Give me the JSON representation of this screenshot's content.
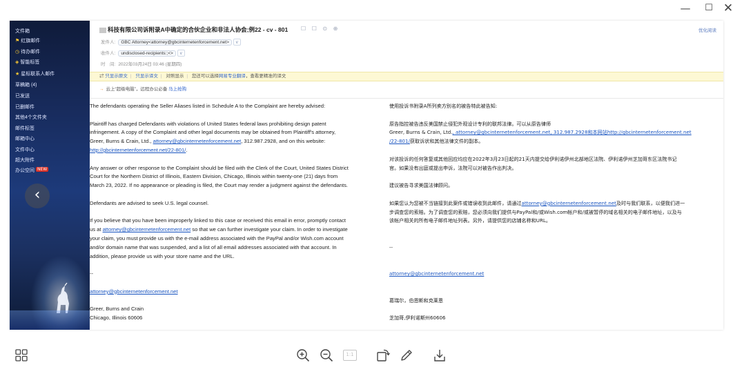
{
  "window": {
    "minimize_glyph": "—",
    "maximize_glyph": "☐",
    "close_glyph": "✕"
  },
  "sidebar": {
    "items": [
      {
        "label": "文件箱",
        "icon": ""
      },
      {
        "label": "红旗邮件",
        "icon": "flag-icon"
      },
      {
        "label": "待办邮件",
        "icon": "clock-icon"
      },
      {
        "label": "智能标签",
        "icon": "tag-icon"
      },
      {
        "label": "星标联系人邮件",
        "icon": "star-icon"
      },
      {
        "label": "草稿箱 (4)",
        "icon": ""
      },
      {
        "label": "已发送",
        "icon": ""
      },
      {
        "label": "已删邮件",
        "icon": ""
      },
      {
        "label": "其他4个文件夹",
        "icon": ""
      },
      {
        "label": "邮件标签",
        "icon": ""
      },
      {
        "label": "邮箱中心",
        "icon": ""
      },
      {
        "label": "文件中心",
        "icon": ""
      },
      {
        "label": "超大附件",
        "icon": ""
      },
      {
        "label": "办公空间",
        "icon": ""
      }
    ],
    "new_badge": "NEW"
  },
  "mail": {
    "subject": "科技有限公司诉附录A中确定的合伙企业和非法人协会;例22 - cv - 801",
    "subject_icons": "☐ ☐ ⊙ ⊕",
    "header_right_link": "优化阅读",
    "from_label": "发件人:",
    "from_value": "GBC Attorney<attorney@gbcinternetenforcement.net>",
    "to_label": "收件人:",
    "to_value": "undisclosed-recipients:;<>",
    "time_label": "时　间:",
    "time_value": "2022年03月24日 03:46 (星期四)",
    "notice": {
      "show_original": "只显示原文",
      "show_translation": "只显示译文",
      "compare": "对照显示",
      "text": "您还可以选择",
      "pro_link": "网易专业翻译",
      "tail": "，查看更精准的译文"
    },
    "cloud": {
      "text": "云上“超级电脑”，远程办公必备",
      "link": "马上抢购"
    }
  },
  "body_en": {
    "p1": [
      "The defendants operating the Seller Aliases listed in Schedule A to the Complaint are hereby advised:"
    ],
    "p2": [
      "Plaintiff has charged Defendants with violations of United States federal laws prohibiting design patent",
      "infringement. A copy of the Complaint and other legal documents may be obtained from Plaintiff's attorney,",
      "Greer, Burns & Crain, Ltd., ",
      "attorney@gbcinternetenforcement.net",
      ", 312.987.2928, and on this website:",
      "http://gbcinternetenforcement.net/22-801/",
      "."
    ],
    "p3": [
      "Any answer or other response to the Complaint should be filed with the Clerk of the Court, United States District",
      "Court for the Northern District of Illinois, Eastern Division, Chicago, Illinois within twenty-one (21) days from",
      "March 23, 2022. If no appearance or pleading is filed, the Court may render a judgment against the defendants."
    ],
    "p4": [
      "Defendants are advised to seek U.S. legal counsel."
    ],
    "p5": [
      "If you believe that you have been improperly linked to this case or received this email in error, promptly contact",
      "us at ",
      "attorney@gbcinternetenforcement.net",
      " so that we can further investigate your claim.  In order to investigate",
      "your claim, you must provide us with the e-mail address associated with the PayPal and/or Wish.com account",
      "and/or domain name that was suspended, and a list of all email addresses associated with that account. In",
      "addition, please provide us with your store name and the URL."
    ],
    "dash": "--",
    "sig_email": "attorney@gbcinternetenforcement.net",
    "sig_firm": "Greer, Burns and Crain",
    "sig_city": "Chicago, Illinois 60606"
  },
  "body_zh": {
    "p1": "使用投诉书附录A所列卖方别名的被告特此被告知:",
    "p2a": "原告指控被告违反美国禁止侵犯外观设计专利的联邦法律。可以从原告律师",
    "p2b_pre": "Greer, Burns & Crain, Ltd.",
    "p2b_link": ", attorney@gbcinternetenforcement.net, 312.987.2928和本网站http://gbcinternetenforcement.net",
    "p2c_link": "/22-801/",
    "p2c_post": "获取诉状和其他法律文件的副本。",
    "p3a": "对该投诉的任何答复或其他回应均应在2022年3月23日起的21天内提交给伊利诺伊州北部地区法院、伊利诺伊州芝加哥东区法院书记",
    "p3b": "官。如果没有出庭或提出申诉，法院可以对被告作出判决。",
    "p4": "建议被告寻求美国法律顾问。",
    "p5a_pre": "如果您认为您被不当链接到此案件或错误收到此邮件，请通过",
    "p5a_link": "attorney@gbcinternetenforcement.net",
    "p5a_post": "及时与我们联系，以便我们进一",
    "p5b": "步调查您的索赔。为了调查您的索赔，您必须向我们提供与PayPal和/或Wish.com帐户和/或被暂停的域名相关的电子邮件地址，以及与",
    "p5c": "该帐户相关的所有电子邮件地址列表。另外，请提供您的店铺名称和URL。",
    "dash": "--",
    "sig_email": "attorney@gbcinternetenforcement.net",
    "sig_firm": "葛瑞尔，伯恩斯和克莱恩",
    "sig_city": "芝加哥,伊利诺斯州60606"
  },
  "toolbar": {
    "actual_size_label": "1:1",
    "buttons": [
      "thumbnails-icon",
      "zoom-in-icon",
      "zoom-out-icon",
      "actual-size-icon",
      "rotate-icon",
      "edit-icon",
      "save-icon"
    ]
  }
}
